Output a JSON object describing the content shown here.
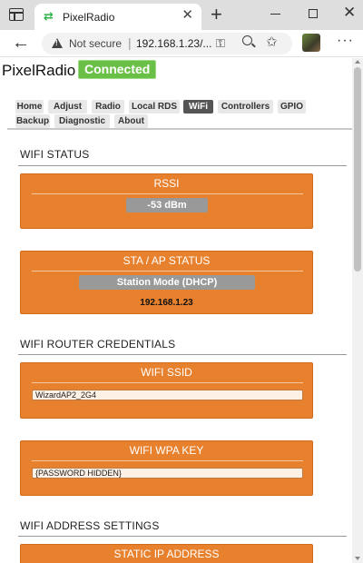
{
  "browser": {
    "tab_title": "PixelRadio",
    "tab_favicon": "⇄",
    "tab_close": "✕",
    "new_tab": "+",
    "close_window": "✕",
    "back": "←",
    "security_text": "Not secure",
    "url_separator": "|",
    "url": "192.168.1.23/...",
    "key_glyph": "⚿",
    "favorites_glyph": "✩",
    "more_glyph": "···"
  },
  "app": {
    "brand": "PixelRadio",
    "status_badge": "Connected",
    "status_color": "#6abf46",
    "accent_color": "#e8812e"
  },
  "menu": {
    "items": [
      "Home",
      "Adjust",
      "Radio",
      "Local RDS",
      "WiFi",
      "Controllers",
      "GPIO",
      "Backup",
      "Diagnostic",
      "About"
    ],
    "active": "WiFi"
  },
  "sections": {
    "wifi_status": "WIFI STATUS",
    "router_credentials": "WIFI ROUTER CREDENTIALS",
    "address_settings": "WIFI ADDRESS SETTINGS"
  },
  "cards": {
    "rssi": {
      "title": "RSSI",
      "value": "-53 dBm"
    },
    "sta_ap": {
      "title": "STA / AP STATUS",
      "mode": "Station Mode (DHCP)",
      "ip": "192.168.1.23"
    },
    "ssid": {
      "title": "WIFI SSID",
      "value": "WizardAP2_2G4"
    },
    "wpa": {
      "title": "WIFI WPA KEY",
      "value": "{PASSWORD HIDDEN}"
    },
    "static_ip": {
      "title": "STATIC IP ADDRESS"
    }
  }
}
